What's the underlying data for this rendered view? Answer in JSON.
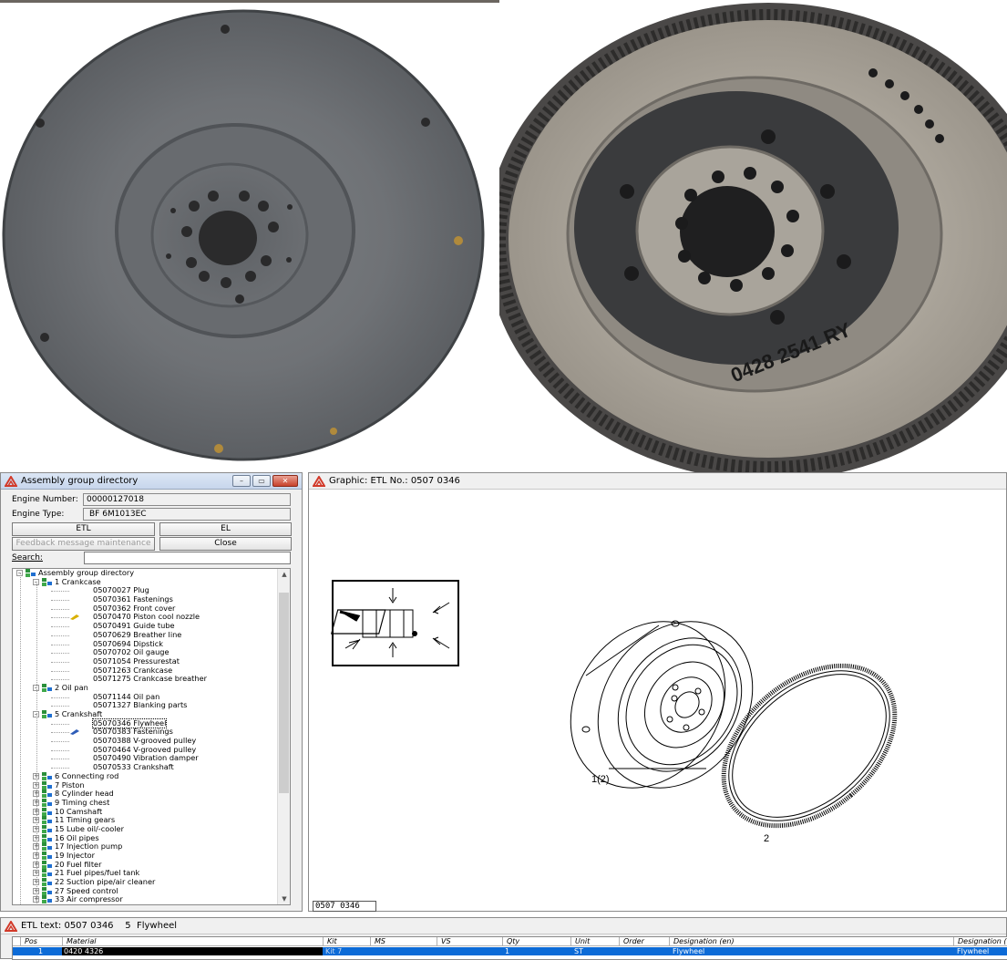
{
  "assembly_window": {
    "title": "Assembly group directory",
    "engine_number_label": "Engine Number:",
    "engine_number_value": "00000127018",
    "engine_type_label": "Engine Type:",
    "engine_type_value": "BF 6M1013EC",
    "buttons": {
      "etl": "ETL",
      "el": "EL",
      "feedback": "Feedback message maintenance",
      "close": "Close"
    },
    "search_label": "Search:",
    "search_value": "",
    "window_controls": [
      "minimize",
      "maximize",
      "close"
    ],
    "tree": [
      {
        "level": 0,
        "label": "Assembly group directory",
        "expanded": true,
        "icon": "network-icon"
      },
      {
        "level": 1,
        "label": "1  Crankcase",
        "expanded": true,
        "icon": "folder-network-icon"
      },
      {
        "level": 2,
        "label": "05070027  Plug"
      },
      {
        "level": 2,
        "label": "05070361  Fastenings"
      },
      {
        "level": 2,
        "label": "05070362  Front cover"
      },
      {
        "level": 2,
        "label": "05070470  Piston cool nozzle",
        "icon": "nozzle-icon"
      },
      {
        "level": 2,
        "label": "05070491  Guide tube"
      },
      {
        "level": 2,
        "label": "05070629  Breather line"
      },
      {
        "level": 2,
        "label": "05070694  Dipstick"
      },
      {
        "level": 2,
        "label": "05070702  Oil gauge"
      },
      {
        "level": 2,
        "label": "05071054  Pressurestat"
      },
      {
        "level": 2,
        "label": "05071263  Crankcase"
      },
      {
        "level": 2,
        "label": "05071275  Crankcase breather"
      },
      {
        "level": 1,
        "label": "2  Oil pan",
        "expanded": true,
        "icon": "folder-network-icon"
      },
      {
        "level": 2,
        "label": "05071144  Oil pan"
      },
      {
        "level": 2,
        "label": "05071327  Blanking parts"
      },
      {
        "level": 1,
        "label": "5  Crankshaft",
        "expanded": true,
        "icon": "folder-network-icon"
      },
      {
        "level": 2,
        "label": "05070346  Flywheel",
        "selected": true
      },
      {
        "level": 2,
        "label": "05070383  Fastenings",
        "icon": "fastener-icon"
      },
      {
        "level": 2,
        "label": "05070388  V-grooved pulley"
      },
      {
        "level": 2,
        "label": "05070464  V-grooved pulley"
      },
      {
        "level": 2,
        "label": "05070490  Vibration damper"
      },
      {
        "level": 2,
        "label": "05070533  Crankshaft"
      },
      {
        "level": 1,
        "label": "6  Connecting rod",
        "expanded": false,
        "icon": "folder-network-icon"
      },
      {
        "level": 1,
        "label": "7  Piston",
        "expanded": false,
        "icon": "folder-network-icon"
      },
      {
        "level": 1,
        "label": "8  Cylinder head",
        "expanded": false,
        "icon": "folder-network-icon"
      },
      {
        "level": 1,
        "label": "9  Timing chest",
        "expanded": false,
        "icon": "folder-network-icon"
      },
      {
        "level": 1,
        "label": "10  Camshaft",
        "expanded": false,
        "icon": "folder-network-icon"
      },
      {
        "level": 1,
        "label": "11  Timing gears",
        "expanded": false,
        "icon": "folder-network-icon"
      },
      {
        "level": 1,
        "label": "15  Lube oil/-cooler",
        "expanded": false,
        "icon": "folder-network-icon"
      },
      {
        "level": 1,
        "label": "16  Oil pipes",
        "expanded": false,
        "icon": "folder-network-icon"
      },
      {
        "level": 1,
        "label": "17  Injection pump",
        "expanded": false,
        "icon": "folder-network-icon"
      },
      {
        "level": 1,
        "label": "19  Injector",
        "expanded": false,
        "icon": "folder-network-icon"
      },
      {
        "level": 1,
        "label": "20  Fuel filter",
        "expanded": false,
        "icon": "folder-network-icon"
      },
      {
        "level": 1,
        "label": "21  Fuel pipes/fuel tank",
        "expanded": false,
        "icon": "folder-network-icon"
      },
      {
        "level": 1,
        "label": "22  Suction pipe/air cleaner",
        "expanded": false,
        "icon": "folder-network-icon"
      },
      {
        "level": 1,
        "label": "27  Speed control",
        "expanded": false,
        "icon": "folder-network-icon"
      },
      {
        "level": 1,
        "label": "33  Air compressor",
        "expanded": false,
        "icon": "folder-network-icon"
      }
    ]
  },
  "graphic_window": {
    "title": "Graphic: ETL No.: 0507 0346",
    "callouts": [
      "1(2)",
      "2"
    ],
    "etl_number_box": "0507 0346"
  },
  "etl_window": {
    "title": "ETL text: 0507 0346    5  Flywheel",
    "columns": [
      "Pos",
      "Material",
      "Kit",
      "MS",
      "VS",
      "Qty",
      "Unit",
      "Order",
      "Designation (en)",
      "Designation ("
    ],
    "rows": [
      {
        "pos": "1",
        "material": "0420 4326",
        "kit": "Kit 7",
        "ms": "",
        "vs": "",
        "qty": "1",
        "unit": "ST",
        "order": "",
        "designation_en": "Flywheel",
        "designation_other": "Flywheel"
      }
    ]
  },
  "colors": {
    "selection_blue": "#0c6bd7",
    "title_gradient_top": "#dce7f5",
    "close_button_red": "#c7412b",
    "app_icon_red": "#d23a2a"
  }
}
